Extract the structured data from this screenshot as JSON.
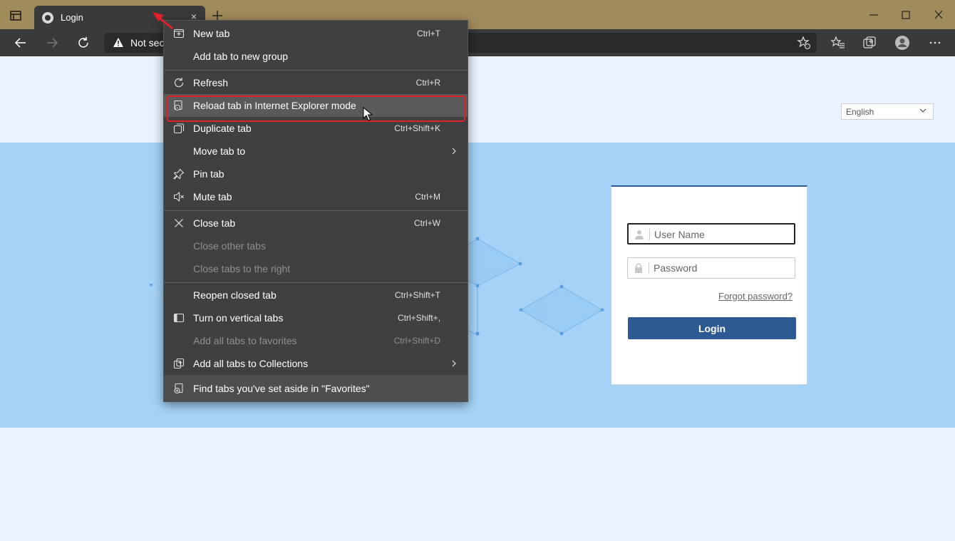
{
  "browser": {
    "tab_title": "Login",
    "tab_close": "×",
    "address_text": "Not sec"
  },
  "page": {
    "language": "English",
    "username_placeholder": "User Name",
    "password_placeholder": "Password",
    "forgot_label": "Forgot password?",
    "login_label": "Login"
  },
  "menu": {
    "new_tab": {
      "label": "New tab",
      "shortcut": "Ctrl+T"
    },
    "add_tab_group": {
      "label": "Add tab to new group"
    },
    "refresh": {
      "label": "Refresh",
      "shortcut": "Ctrl+R"
    },
    "reload_ie": {
      "label": "Reload tab in Internet Explorer mode"
    },
    "duplicate": {
      "label": "Duplicate tab",
      "shortcut": "Ctrl+Shift+K"
    },
    "move_tab": {
      "label": "Move tab to"
    },
    "pin_tab": {
      "label": "Pin tab"
    },
    "mute_tab": {
      "label": "Mute tab",
      "shortcut": "Ctrl+M"
    },
    "close_tab": {
      "label": "Close tab",
      "shortcut": "Ctrl+W"
    },
    "close_other": {
      "label": "Close other tabs"
    },
    "close_right": {
      "label": "Close tabs to the right"
    },
    "reopen": {
      "label": "Reopen closed tab",
      "shortcut": "Ctrl+Shift+T"
    },
    "vertical_tabs": {
      "label": "Turn on vertical tabs",
      "shortcut": "Ctrl+Shift+,"
    },
    "add_favorites": {
      "label": "Add all tabs to favorites",
      "shortcut": "Ctrl+Shift+D"
    },
    "add_collections": {
      "label": "Add all tabs to Collections"
    },
    "find_aside": {
      "label": "Find tabs you've set aside in \"Favorites\""
    }
  }
}
